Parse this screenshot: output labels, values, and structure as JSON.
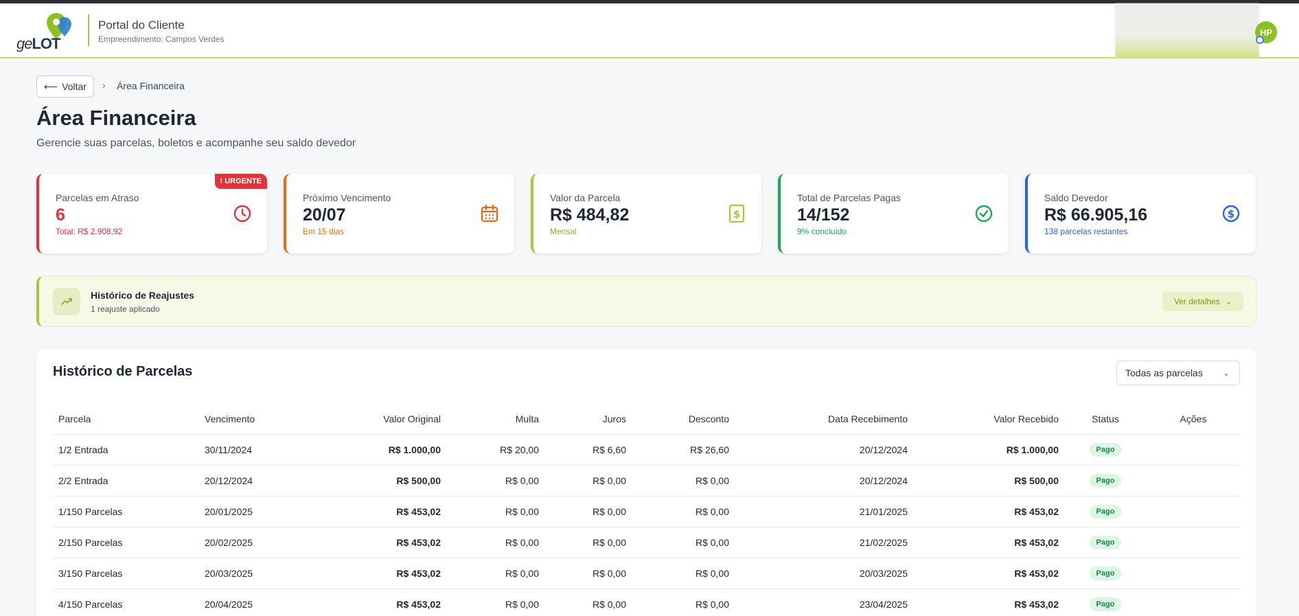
{
  "header": {
    "logo_prefix": "ge",
    "logo_brand": "LOT",
    "portal_title": "Portal do Cliente",
    "portal_subtitle": "Empreendimento: Campos Verdes",
    "avatar_initials": "HP"
  },
  "breadcrumb": {
    "back_label": "Voltar",
    "current": "Área Financeira"
  },
  "page": {
    "title": "Área Financeira",
    "subtitle": "Gerencie suas parcelas, boletos e acompanhe seu saldo devedor"
  },
  "cards": [
    {
      "label": "Parcelas em Atraso",
      "value": "6",
      "note": "Total: R$ 2.908,92",
      "badge": "! URGENTE",
      "color": "#e5323a",
      "icon": "clock-icon"
    },
    {
      "label": "Próximo Vencimento",
      "value": "20/07",
      "note": "Em 15 dias",
      "color": "#ea6a12",
      "icon": "calendar-icon"
    },
    {
      "label": "Valor da Parcela",
      "value": "R$ 484,82",
      "note": "Mensal",
      "color": "#a7c73a",
      "icon": "receipt-dollar-icon"
    },
    {
      "label": "Total de Parcelas Pagas",
      "value": "14/152",
      "note": "9% concluído",
      "color": "#1aa957",
      "icon": "check-circle-icon"
    },
    {
      "label": "Saldo Devedor",
      "value": "R$ 66.905,16",
      "note": "138 parcelas restantes",
      "color": "#2563eb",
      "icon": "dollar-circle-icon"
    }
  ],
  "reajustes": {
    "title": "Histórico de Reajustes",
    "subtitle": "1 reajuste aplicado",
    "button": "Ver detalhes",
    "icon": "trending-up-icon"
  },
  "parcelas": {
    "title": "Histórico de Parcelas",
    "filter": "Todas as parcelas",
    "columns": [
      "Parcela",
      "Vencimento",
      "Valor Original",
      "Multa",
      "Juros",
      "Desconto",
      "Data Recebimento",
      "Valor Recebido",
      "Status",
      "Ações"
    ],
    "rows": [
      [
        "1/2 Entrada",
        "30/11/2024",
        "R$ 1.000,00",
        "R$ 20,00",
        "R$ 6,60",
        "R$ 26,60",
        "20/12/2024",
        "R$ 1.000,00",
        "Pago"
      ],
      [
        "2/2 Entrada",
        "20/12/2024",
        "R$ 500,00",
        "R$ 0,00",
        "R$ 0,00",
        "R$ 0,00",
        "20/12/2024",
        "R$ 500,00",
        "Pago"
      ],
      [
        "1/150 Parcelas",
        "20/01/2025",
        "R$ 453,02",
        "R$ 0,00",
        "R$ 0,00",
        "R$ 0,00",
        "21/01/2025",
        "R$ 453,02",
        "Pago"
      ],
      [
        "2/150 Parcelas",
        "20/02/2025",
        "R$ 453,02",
        "R$ 0,00",
        "R$ 0,00",
        "R$ 0,00",
        "21/02/2025",
        "R$ 453,02",
        "Pago"
      ],
      [
        "3/150 Parcelas",
        "20/03/2025",
        "R$ 453,02",
        "R$ 0,00",
        "R$ 0,00",
        "R$ 0,00",
        "20/03/2025",
        "R$ 453,02",
        "Pago"
      ],
      [
        "4/150 Parcelas",
        "20/04/2025",
        "R$ 453,02",
        "R$ 0,00",
        "R$ 0,00",
        "R$ 0,00",
        "23/04/2025",
        "R$ 453,02",
        "Pago"
      ]
    ]
  }
}
